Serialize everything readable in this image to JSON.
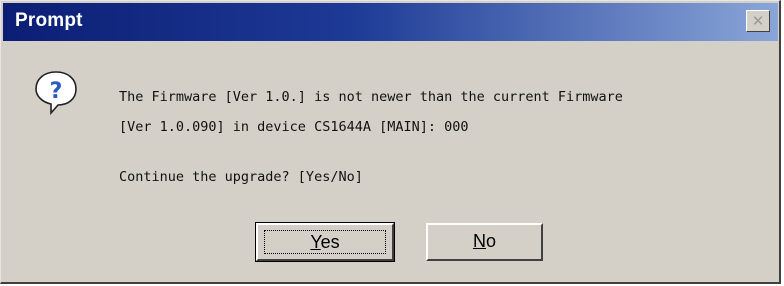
{
  "window": {
    "title": "Prompt",
    "close_glyph": "✕"
  },
  "icon": {
    "name": "question-icon"
  },
  "message": {
    "line1": "The Firmware [Ver 1.0.] is not newer than the current Firmware",
    "line2": "[Ver 1.0.090] in device CS1644A [MAIN]: 000",
    "line3": "Continue the upgrade? [Yes/No]"
  },
  "buttons": {
    "yes": {
      "first": "Y",
      "rest": "es"
    },
    "no": {
      "first": "N",
      "rest": "o"
    }
  },
  "colors": {
    "titlebar_start": "#0c1e74",
    "titlebar_end": "#8aa6d8",
    "face": "#d4d0c8",
    "icon_blue": "#2a5bc0"
  }
}
